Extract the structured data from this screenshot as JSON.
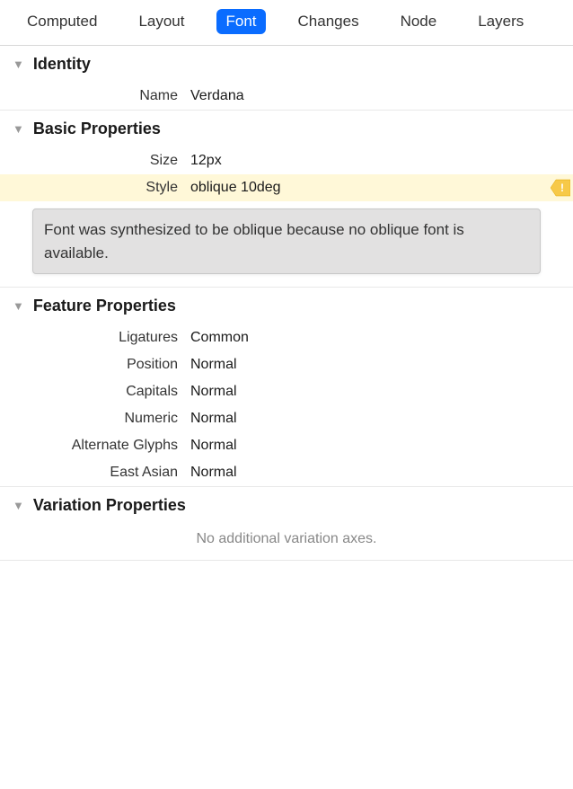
{
  "tabs": {
    "computed": "Computed",
    "layout": "Layout",
    "font": "Font",
    "changes": "Changes",
    "node": "Node",
    "layers": "Layers"
  },
  "sections": {
    "identity": {
      "title": "Identity",
      "name_label": "Name",
      "name_value": "Verdana"
    },
    "basic": {
      "title": "Basic Properties",
      "size_label": "Size",
      "size_value": "12px",
      "style_label": "Style",
      "style_value": "oblique 10deg",
      "warning_tooltip": "Font was synthesized to be oblique because no oblique font is available."
    },
    "feature": {
      "title": "Feature Properties",
      "ligatures_label": "Ligatures",
      "ligatures_value": "Common",
      "position_label": "Position",
      "position_value": "Normal",
      "capitals_label": "Capitals",
      "capitals_value": "Normal",
      "numeric_label": "Numeric",
      "numeric_value": "Normal",
      "alternate_label": "Alternate Glyphs",
      "alternate_value": "Normal",
      "eastasian_label": "East Asian",
      "eastasian_value": "Normal"
    },
    "variation": {
      "title": "Variation Properties",
      "empty": "No additional variation axes."
    }
  }
}
